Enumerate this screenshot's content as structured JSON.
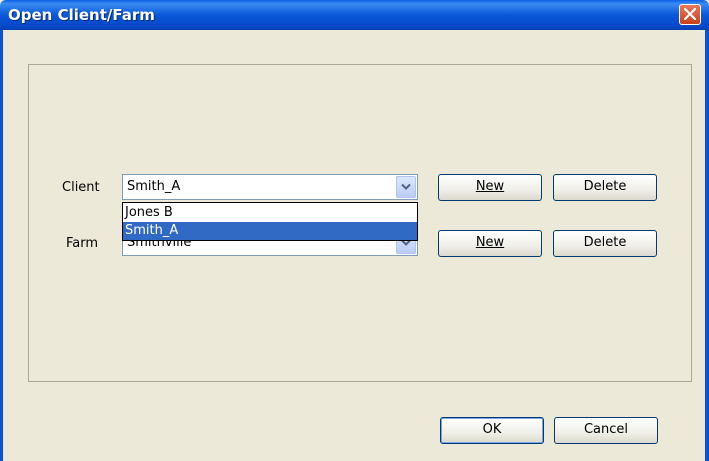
{
  "window": {
    "title": "Open Client/Farm"
  },
  "client": {
    "label": "Client",
    "value": "Smith_A",
    "new_label": "New",
    "delete_label": "Delete",
    "dropdown_options": [
      "Jones B",
      "Smith_A"
    ],
    "selected_option": "Smith_A"
  },
  "farm": {
    "label": "Farm",
    "value": "Smithville",
    "new_label": "New",
    "delete_label": "Delete"
  },
  "footer": {
    "ok_label": "OK",
    "cancel_label": "Cancel"
  },
  "icons": {
    "close": "close-icon",
    "dropdown": "chevron-down-icon"
  },
  "colors": {
    "titlebar": "#0a58d8",
    "selection": "#316ac5",
    "dialog_bg": "#ece9d8"
  }
}
